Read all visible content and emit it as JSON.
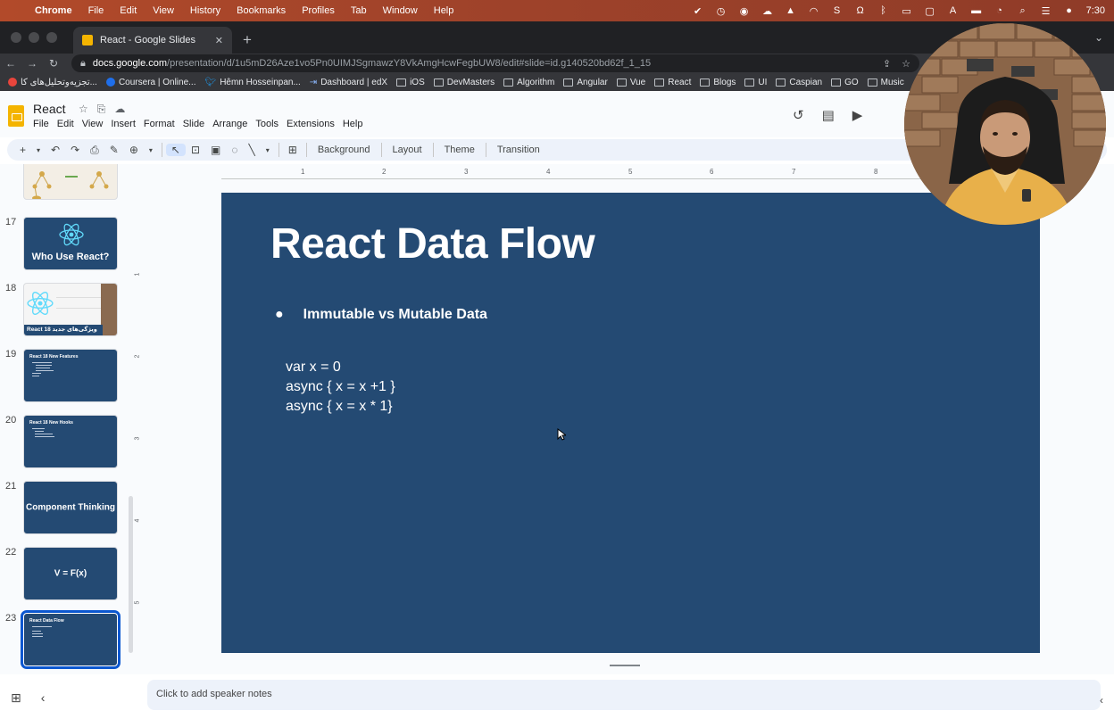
{
  "menubar": {
    "app": "Chrome",
    "items": [
      "File",
      "Edit",
      "View",
      "History",
      "Bookmarks",
      "Profiles",
      "Tab",
      "Window",
      "Help"
    ],
    "clock": "7:30"
  },
  "tab": {
    "title": "React - Google Slides"
  },
  "address": {
    "host": "docs.google.com",
    "path": "/presentation/d/1u5mD26Aze1vo5Pn0UIMJSgmawzY8VkAmgHcwFegbUW8/edit#slide=id.g140520bd62f_1_15"
  },
  "bookmarks": [
    "تجزیه‌وتحلیل‌های کا...",
    "Coursera | Online...",
    "Hêmn Hosseinpan...",
    "Dashboard | edX",
    "iOS",
    "DevMasters",
    "Algorithm",
    "Angular",
    "Vue",
    "React",
    "Blogs",
    "UI",
    "Caspian",
    "GO",
    "Music"
  ],
  "doc": {
    "name": "React",
    "menu": [
      "File",
      "Edit",
      "View",
      "Insert",
      "Format",
      "Slide",
      "Arrange",
      "Tools",
      "Extensions",
      "Help"
    ]
  },
  "toolbar": {
    "background": "Background",
    "layout": "Layout",
    "theme": "Theme",
    "transition": "Transition"
  },
  "ruler": [
    "1",
    "2",
    "3",
    "4",
    "5",
    "6",
    "7",
    "8"
  ],
  "filmstrip": [
    {
      "num": "17",
      "text": "Who Use React?"
    },
    {
      "num": "18",
      "text": "React 18 ویژگی‌های جدید"
    },
    {
      "num": "19",
      "text": "React 18 New Features"
    },
    {
      "num": "20",
      "text": "React 18 New Hooks"
    },
    {
      "num": "21",
      "text": "Component Thinking"
    },
    {
      "num": "22",
      "text": "V = F(x)"
    },
    {
      "num": "23",
      "text": "React Data Flow"
    }
  ],
  "slide": {
    "title": "React Data Flow",
    "bullet": "Immutable vs Mutable Data",
    "code": [
      "var x = 0",
      "async  { x = x +1 }",
      "async  { x = x * 1}"
    ],
    "background_color": "#244a73"
  },
  "notes": {
    "placeholder": "Click to add speaker notes"
  }
}
